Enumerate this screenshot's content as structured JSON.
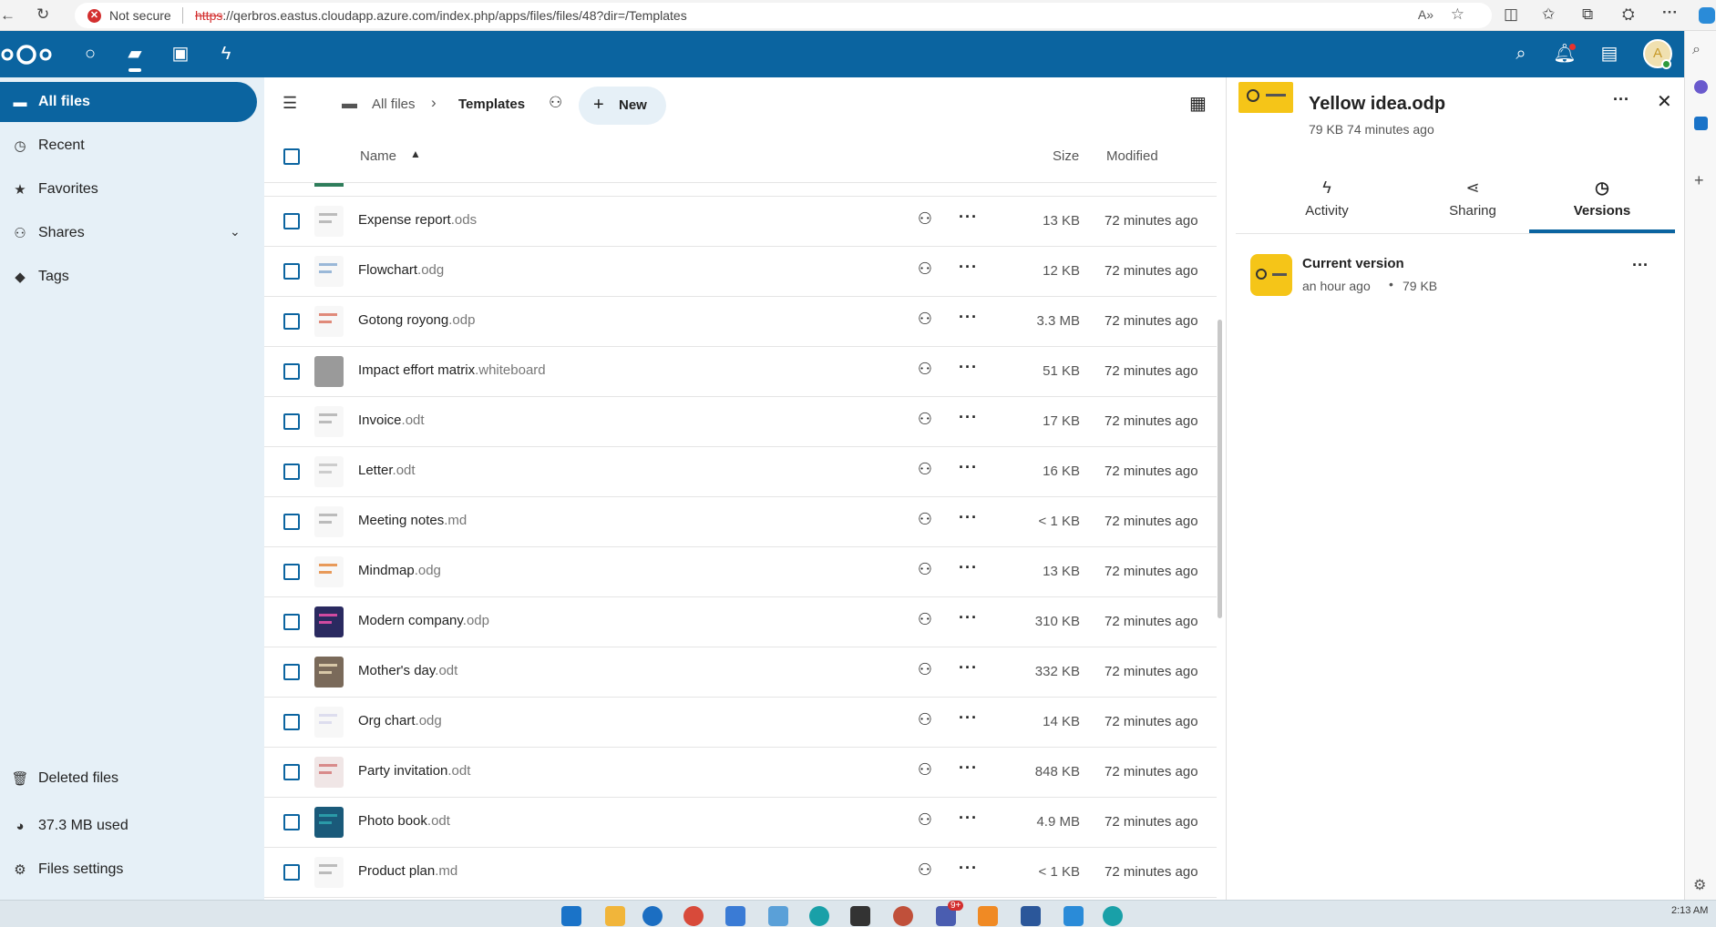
{
  "browser": {
    "security_label": "Not secure",
    "url_scheme": "https",
    "url_rest": "://qerbros.eastus.cloudapp.azure.com/index.php/apps/files/files/48?dir=/Templates"
  },
  "sidebar": {
    "items": [
      {
        "label": "All files",
        "icon": "folder-icon"
      },
      {
        "label": "Recent",
        "icon": "history-icon"
      },
      {
        "label": "Favorites",
        "icon": "star-icon"
      },
      {
        "label": "Shares",
        "icon": "share-icon"
      },
      {
        "label": "Tags",
        "icon": "tag-icon"
      }
    ],
    "bottom": {
      "deleted": "Deleted files",
      "quota": "37.3 MB used",
      "settings": "Files settings"
    }
  },
  "breadcrumb": {
    "root": "All files",
    "current": "Templates",
    "new_label": "New"
  },
  "table": {
    "headers": {
      "name": "Name",
      "size": "Size",
      "modified": "Modified"
    },
    "rows": [
      {
        "name": "Expense report",
        "ext": ".ods",
        "size": "13 KB",
        "modified": "72 minutes ago"
      },
      {
        "name": "Flowchart",
        "ext": ".odg",
        "size": "12 KB",
        "modified": "72 minutes ago"
      },
      {
        "name": "Gotong royong",
        "ext": ".odp",
        "size": "3.3 MB",
        "modified": "72 minutes ago"
      },
      {
        "name": "Impact effort matrix",
        "ext": ".whiteboard",
        "size": "51 KB",
        "modified": "72 minutes ago"
      },
      {
        "name": "Invoice",
        "ext": ".odt",
        "size": "17 KB",
        "modified": "72 minutes ago"
      },
      {
        "name": "Letter",
        "ext": ".odt",
        "size": "16 KB",
        "modified": "72 minutes ago"
      },
      {
        "name": "Meeting notes",
        "ext": ".md",
        "size": "< 1 KB",
        "modified": "72 minutes ago"
      },
      {
        "name": "Mindmap",
        "ext": ".odg",
        "size": "13 KB",
        "modified": "72 minutes ago"
      },
      {
        "name": "Modern company",
        "ext": ".odp",
        "size": "310 KB",
        "modified": "72 minutes ago"
      },
      {
        "name": "Mother's day",
        "ext": ".odt",
        "size": "332 KB",
        "modified": "72 minutes ago"
      },
      {
        "name": "Org chart",
        "ext": ".odg",
        "size": "14 KB",
        "modified": "72 minutes ago"
      },
      {
        "name": "Party invitation",
        "ext": ".odt",
        "size": "848 KB",
        "modified": "72 minutes ago"
      },
      {
        "name": "Photo book",
        "ext": ".odt",
        "size": "4.9 MB",
        "modified": "72 minutes ago"
      },
      {
        "name": "Product plan",
        "ext": ".md",
        "size": "< 1 KB",
        "modified": "72 minutes ago"
      }
    ]
  },
  "details": {
    "title": "Yellow idea.odp",
    "subtitle": "79 KB 74 minutes ago",
    "tabs": [
      {
        "label": "Activity",
        "icon": "bolt-icon"
      },
      {
        "label": "Sharing",
        "icon": "share-nodes-icon"
      },
      {
        "label": "Versions",
        "icon": "history-icon"
      }
    ],
    "version": {
      "title": "Current version",
      "when": "an hour ago",
      "size": "79 KB"
    }
  },
  "taskbar": {
    "clock": "2:13 AM",
    "badge": "9+"
  },
  "colors": {
    "brand": "#0b64a0",
    "sidebar_bg": "#e6f0f7",
    "danger": "#d32f2f"
  }
}
